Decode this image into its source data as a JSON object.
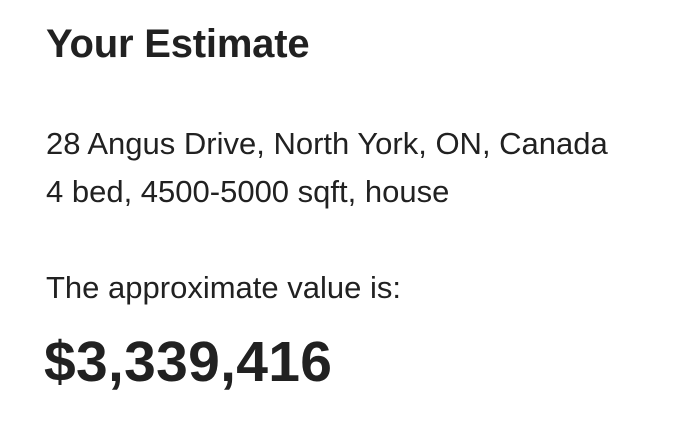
{
  "estimate": {
    "title": "Your Estimate",
    "address": "28 Angus Drive, North York, ON, Canada",
    "details": "4 bed, 4500-5000 sqft, house",
    "value_label": "The approximate value is:",
    "value_amount": "$3,339,416"
  },
  "colors": {
    "text": "#212121",
    "background": "#ffffff"
  }
}
